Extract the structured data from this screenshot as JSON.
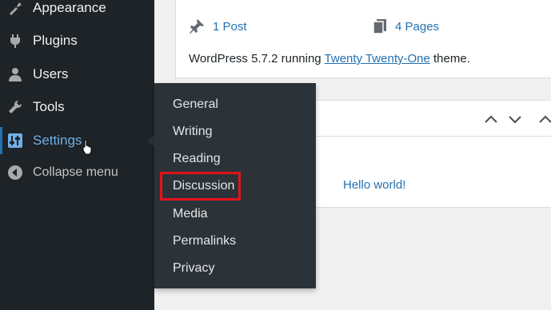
{
  "sidebar": {
    "items": [
      {
        "label": "Appearance",
        "icon": "appearance-icon"
      },
      {
        "label": "Plugins",
        "icon": "plugins-icon"
      },
      {
        "label": "Users",
        "icon": "users-icon"
      },
      {
        "label": "Tools",
        "icon": "tools-icon"
      },
      {
        "label": "Settings",
        "icon": "settings-icon",
        "active": true
      },
      {
        "label": "Collapse menu",
        "icon": "collapse-icon"
      }
    ]
  },
  "submenu": {
    "items": [
      "General",
      "Writing",
      "Reading",
      "Discussion",
      "Media",
      "Permalinks",
      "Privacy"
    ],
    "highlighted": "Discussion",
    "highlight_color": "#e4131b"
  },
  "glance": {
    "posts": "1 Post",
    "pages": "4 Pages",
    "wp_prefix": "WordPress 5.7.2 running ",
    "theme": "Twenty Twenty-One",
    "wp_suffix": " theme."
  },
  "activity": {
    "post_title": "Hello world!"
  },
  "colors": {
    "sidebar_bg": "#1d2327",
    "submenu_bg": "#2c3338",
    "link": "#2271b1",
    "active": "#72aee6"
  }
}
